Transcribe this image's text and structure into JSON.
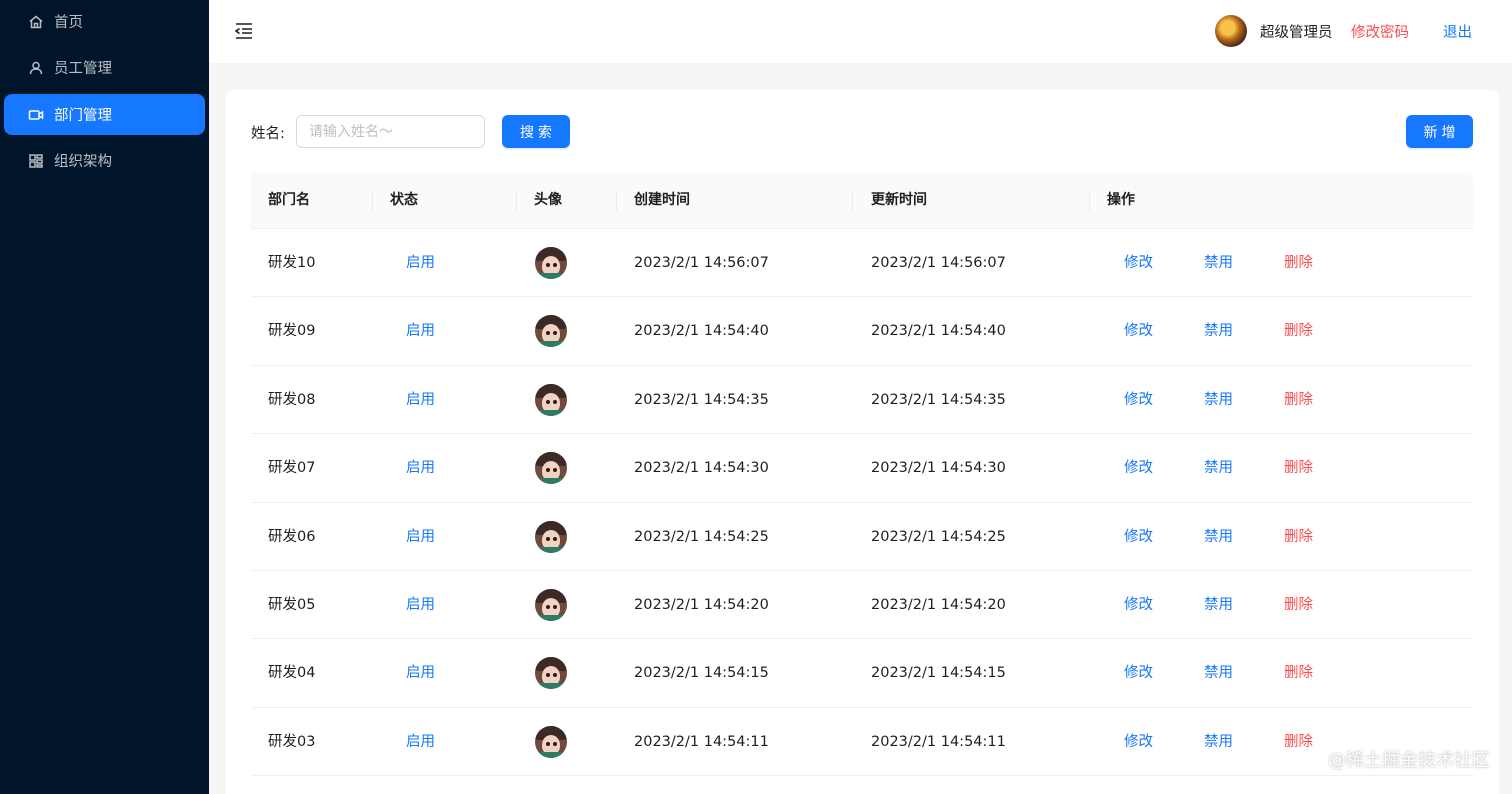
{
  "sidebar": {
    "items": [
      {
        "label": "首页",
        "icon": "home-icon"
      },
      {
        "label": "员工管理",
        "icon": "user-icon"
      },
      {
        "label": "部门管理",
        "icon": "video-icon",
        "active": true
      },
      {
        "label": "组织架构",
        "icon": "org-icon"
      }
    ]
  },
  "header": {
    "user_name": "超级管理员",
    "change_password": "修改密码",
    "logout": "退出"
  },
  "search": {
    "label": "姓名:",
    "placeholder": "请输入姓名～",
    "value": "",
    "search_button": "搜索",
    "add_button": "新增"
  },
  "table": {
    "columns": [
      "部门名",
      "状态",
      "头像",
      "创建时间",
      "更新时间",
      "操作"
    ],
    "rows": [
      {
        "name": "研发10",
        "status": "启用",
        "created": "2023/2/1 14:56:07",
        "updated": "2023/2/1 14:56:07"
      },
      {
        "name": "研发09",
        "status": "启用",
        "created": "2023/2/1 14:54:40",
        "updated": "2023/2/1 14:54:40"
      },
      {
        "name": "研发08",
        "status": "启用",
        "created": "2023/2/1 14:54:35",
        "updated": "2023/2/1 14:54:35"
      },
      {
        "name": "研发07",
        "status": "启用",
        "created": "2023/2/1 14:54:30",
        "updated": "2023/2/1 14:54:30"
      },
      {
        "name": "研发06",
        "status": "启用",
        "created": "2023/2/1 14:54:25",
        "updated": "2023/2/1 14:54:25"
      },
      {
        "name": "研发05",
        "status": "启用",
        "created": "2023/2/1 14:54:20",
        "updated": "2023/2/1 14:54:20"
      },
      {
        "name": "研发04",
        "status": "启用",
        "created": "2023/2/1 14:54:15",
        "updated": "2023/2/1 14:54:15"
      },
      {
        "name": "研发03",
        "status": "启用",
        "created": "2023/2/1 14:54:11",
        "updated": "2023/2/1 14:54:11"
      }
    ],
    "actions": {
      "edit": "修改",
      "disable": "禁用",
      "delete": "删除"
    }
  },
  "watermark": "@稀土掘金技术社区",
  "colors": {
    "primary": "#1677ff",
    "danger": "#ff4d4f",
    "sidebar_bg": "#001529"
  }
}
